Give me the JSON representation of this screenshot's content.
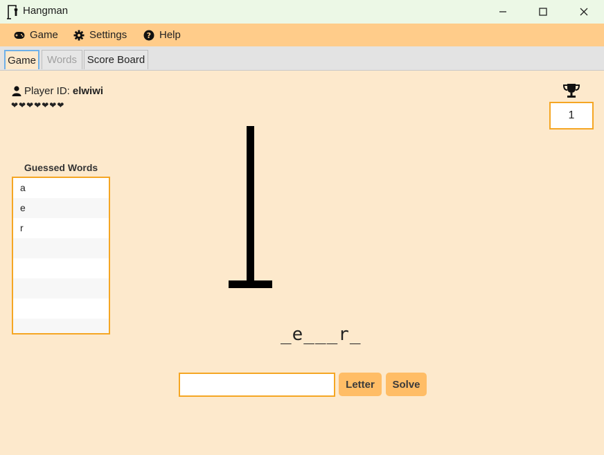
{
  "window": {
    "title": "Hangman"
  },
  "menu": {
    "items": [
      {
        "label": "Game"
      },
      {
        "label": "Settings"
      },
      {
        "label": "Help"
      }
    ]
  },
  "tabs": [
    {
      "label": "Game"
    },
    {
      "label": "Words"
    },
    {
      "label": "Score Board"
    }
  ],
  "player": {
    "id_label": "Player ID:",
    "id_value": "elwiwi",
    "lives": 7,
    "hearts": "❤❤❤❤❤❤❤"
  },
  "score": {
    "value": "1"
  },
  "guessed_words": {
    "title": "Guessed Words",
    "items": [
      "a",
      "e",
      "r",
      "",
      "",
      "",
      "",
      ""
    ]
  },
  "puzzle": {
    "masked_word": "_e___r_"
  },
  "input": {
    "value": "",
    "placeholder": ""
  },
  "buttons": {
    "letter": "Letter",
    "solve": "Solve"
  },
  "colors": {
    "background": "#fde9cc",
    "menu": "#ffcc8a",
    "titlebar": "#ecf8e6",
    "accent": "#f5a623",
    "button": "#ffbd66"
  },
  "icons": {
    "app": "hangman-app-icon",
    "game": "gamepad-icon",
    "settings": "gear-icon",
    "help": "question-circle-icon",
    "player": "user-icon",
    "trophy": "trophy-icon"
  }
}
